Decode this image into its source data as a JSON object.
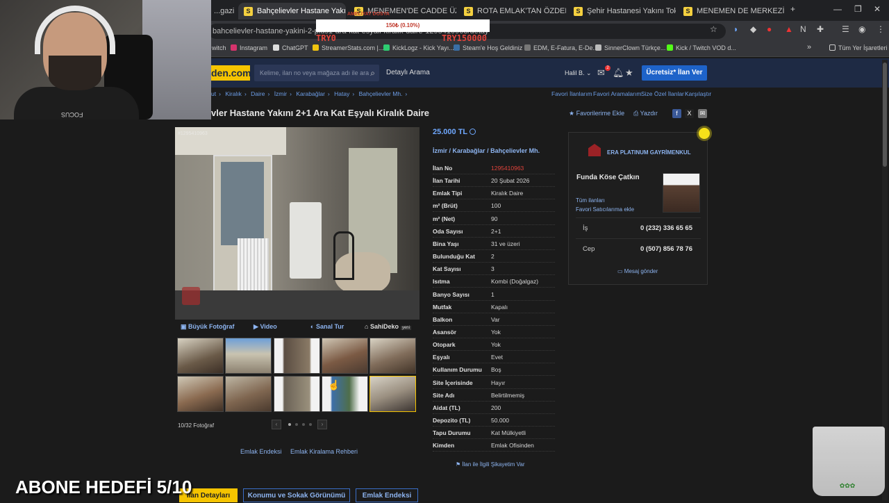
{
  "browser": {
    "tabs": [
      {
        "label": "...gazi",
        "active": false
      },
      {
        "label": "Bahçelievler Hastane Yakını 2+",
        "active": true
      },
      {
        "label": "MENEMEN'DE CADDE ÜZERİNE",
        "active": false
      },
      {
        "label": "ROTA EMLAK'TAN ÖZDERE ÇU",
        "active": false
      },
      {
        "label": "Şehir Hastanesi Yakını Toki'de",
        "active": false
      },
      {
        "label": "MENEMEN DE MERKEZİ YERDE",
        "active": false
      }
    ],
    "url": "bahcelievler-hastane-yakini-2-plus1-ara-kat-esyali-kiralik-daire-1295410963/detay",
    "bookmarks": [
      "witch",
      "Instagram",
      "ChatGPT",
      "StreamerStats.com |...",
      "KickLogz - Kick Yayı...",
      "Steam'e Hoş Geldiniz",
      "EDM, E-Fatura, E-De...",
      "SinnerClown Türkçe...",
      "Kick / Twitch VOD d..."
    ],
    "bookmarks_all": "Tüm Yer İşaretleri"
  },
  "site": {
    "logo": "den.com",
    "search_placeholder": "Kelime, ilan no veya mağaza adı ile ara",
    "detailed_search": "Detaylı Arama",
    "user": "Halil B.",
    "notification_count": "2",
    "post_ad": "Ücretsiz* İlan Ver"
  },
  "breadcrumbs": [
    "ut",
    "Kiralık",
    "Daire",
    "İzmir",
    "Karabağlar",
    "Hatay",
    "Bahçelievler Mh."
  ],
  "right_links": [
    "Favori İlanlarım",
    "Favori Aramalarım",
    "Size Özel İlanlar",
    "Karşılaştır"
  ],
  "listing": {
    "title": "vler Hastane Yakını 2+1 Ara Kat Eşyalı Kiralık Daire",
    "add_favorite": "Favorilerime Ekle",
    "print": "Yazdır",
    "price": "25.000 TL",
    "location": [
      "İzmir",
      "Karabağlar",
      "Bahçelievler Mh."
    ],
    "details": [
      {
        "label": "İlan No",
        "value": "1295410963",
        "highlight": true
      },
      {
        "label": "İlan Tarihi",
        "value": "20 Şubat 2026"
      },
      {
        "label": "Emlak Tipi",
        "value": "Kiralık Daire"
      },
      {
        "label": "m² (Brüt)",
        "value": "100"
      },
      {
        "label": "m² (Net)",
        "value": "90"
      },
      {
        "label": "Oda Sayısı",
        "value": "2+1"
      },
      {
        "label": "Bina Yaşı",
        "value": "31 ve üzeri"
      },
      {
        "label": "Bulunduğu Kat",
        "value": "2"
      },
      {
        "label": "Kat Sayısı",
        "value": "3"
      },
      {
        "label": "Isıtma",
        "value": "Kombi (Doğalgaz)"
      },
      {
        "label": "Banyo Sayısı",
        "value": "1"
      },
      {
        "label": "Mutfak",
        "value": "Kapalı"
      },
      {
        "label": "Balkon",
        "value": "Var"
      },
      {
        "label": "Asansör",
        "value": "Yok"
      },
      {
        "label": "Otopark",
        "value": "Yok"
      },
      {
        "label": "Eşyalı",
        "value": "Evet"
      },
      {
        "label": "Kullanım Durumu",
        "value": "Boş"
      },
      {
        "label": "Site İçerisinde",
        "value": "Hayır"
      },
      {
        "label": "Site Adı",
        "value": "Belirtilmemiş"
      },
      {
        "label": "Aidat (TL)",
        "value": "200"
      },
      {
        "label": "Depozito (TL)",
        "value": "50.000"
      },
      {
        "label": "Tapu Durumu",
        "value": "Kat Mülkiyetli"
      },
      {
        "label": "Kimden",
        "value": "Emlak Ofisinden"
      }
    ],
    "complaint": "İlan ile İlgili Şikayetim Var"
  },
  "photo": {
    "watermark": "#1295410963",
    "tabs": [
      "Büyük Fotoğraf",
      "Video",
      "Sanal Tur",
      "SahiDeko"
    ],
    "new_badge": "yeni",
    "count": "10/32 Fotoğraf"
  },
  "bottom_links": [
    "Emlak Endeksi",
    "Emlak Kiralama Rehberi"
  ],
  "bottom_tabs": [
    "İlan Detayları",
    "Konumu ve Sokak Görünümü",
    "Emlak Endeksi"
  ],
  "agent": {
    "agency": "ERA PLATINUM GAYRİMENKUL",
    "name": "Funda Köse Çatkın",
    "all_listings": "Tüm ilanları",
    "favorite_seller": "Favori Satıcılarıma ekle",
    "phones": [
      {
        "label": "İş",
        "number": "0 (232) 336 65 65"
      },
      {
        "label": "Cep",
        "number": "0 (507) 856 78 76"
      }
    ],
    "message": "Mesaj gönder"
  },
  "overlay": {
    "webcam_label": "FOCUS",
    "alert_top": "AMELİYAT DOSYA",
    "alert": "150₺ (0.10%)",
    "goal_left": "TRY0",
    "goal_right": "TRY150000",
    "subscriber_goal": "ABONE HEDEFİ 5/10"
  }
}
